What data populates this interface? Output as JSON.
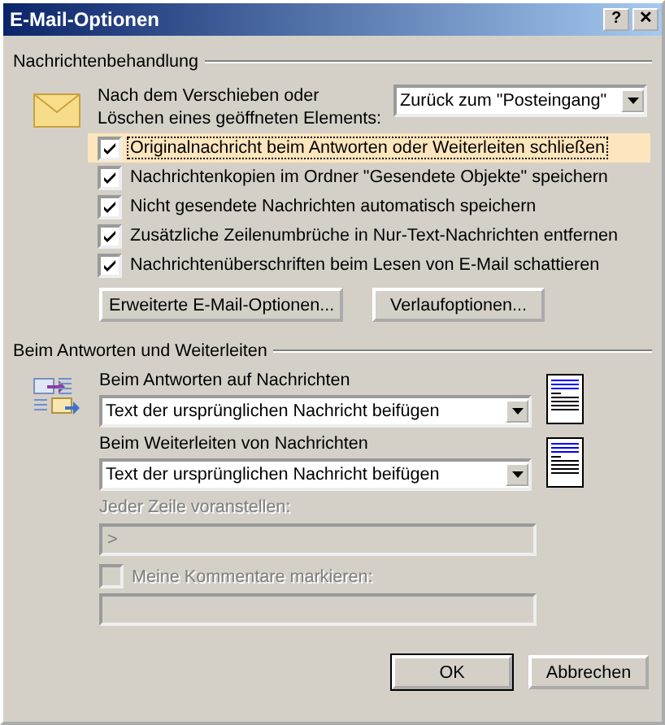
{
  "window": {
    "title": "E-Mail-Optionen",
    "buttons": [
      "?",
      "✕"
    ]
  },
  "handling": {
    "heading": "Nachrichtenbehandlung",
    "move_label": "Nach dem Verschieben oder Löschen eines geöffneten Elements:",
    "move_value": "Zurück zum \"Posteingang\"",
    "options": [
      {
        "label": "Originalnachricht beim Antworten oder Weiterleiten schließen",
        "checked": true,
        "highlighted": true
      },
      {
        "label": "Nachrichtenkopien im Ordner \"Gesendete Objekte\" speichern",
        "checked": true,
        "highlighted": false
      },
      {
        "label": "Nicht gesendete Nachrichten automatisch speichern",
        "checked": true,
        "highlighted": false
      },
      {
        "label": "Zusätzliche Zeilenumbrüche in Nur-Text-Nachrichten entfernen",
        "checked": true,
        "highlighted": false
      },
      {
        "label": "Nachrichtenüberschriften beim Lesen von E-Mail schattieren",
        "checked": true,
        "highlighted": false
      }
    ],
    "buttons": [
      "Erweiterte E-Mail-Optionen...",
      "Verlaufoptionen..."
    ]
  },
  "reply": {
    "heading": "Beim Antworten und Weiterleiten",
    "selects": [
      {
        "label": "Beim Antworten auf Nachrichten",
        "value": "Text der ursprünglichen Nachricht beifügen"
      },
      {
        "label": "Beim Weiterleiten von Nachrichten",
        "value": "Text der ursprünglichen Nachricht beifügen"
      }
    ],
    "prefix_label": "Jeder Zeile voranstellen:",
    "prefix_value": ">",
    "prefix_disabled": true,
    "mark": {
      "label": "Meine Kommentare markieren:",
      "checked": false,
      "disabled": true
    }
  },
  "buttons": [
    "OK",
    "Abbrechen"
  ]
}
